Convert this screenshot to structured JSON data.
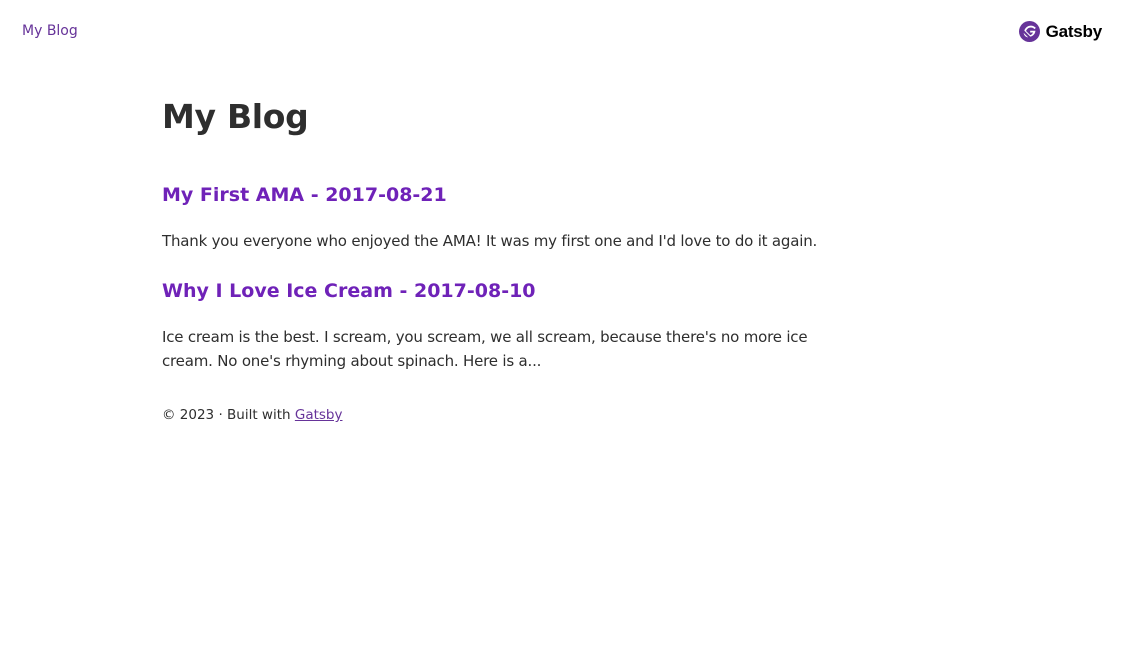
{
  "header": {
    "home_link": "My Blog",
    "brand": {
      "name": "Gatsby",
      "icon": "gatsby-logo-icon",
      "color": "#663399"
    }
  },
  "page": {
    "title": "My Blog"
  },
  "posts": [
    {
      "title": "My First AMA - 2017-08-21",
      "excerpt": "Thank you everyone who enjoyed the AMA! It was my first one and I'd love to do it again."
    },
    {
      "title": "Why I Love Ice Cream - 2017-08-10",
      "excerpt": "Ice cream is the best. I scream, you scream, we all scream, because there's no more ice cream. No one's rhyming about spinach. Here is a..."
    }
  ],
  "footer": {
    "text": "© 2023 · Built with ",
    "link": "Gatsby"
  },
  "colors": {
    "accent": "#663399",
    "heading_link": "#6f22b8",
    "text": "#2e2e2e"
  }
}
